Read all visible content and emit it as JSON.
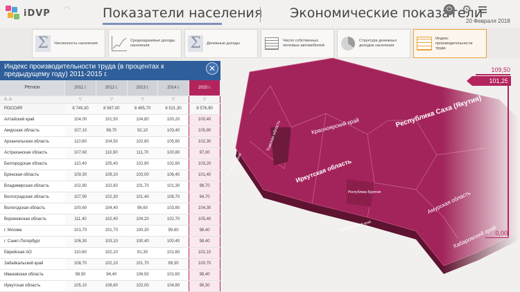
{
  "app": {
    "logo_text": "iDVP"
  },
  "header": {
    "tab_population": "Показатели населения",
    "tab_economy": "Экономические показатели",
    "date": "20 Февраля 2018"
  },
  "indicators": [
    {
      "label": "Численность населения",
      "icon": "sigma-icon"
    },
    {
      "label": "Среднедушевые доходы населения",
      "icon": "line-chart-icon"
    },
    {
      "label": "Денежные доходы",
      "icon": "sigma-icon"
    },
    {
      "label": "Число собственных легковых автомобилей",
      "icon": "grid-icon"
    },
    {
      "label": "Структура денежных доходов населения",
      "icon": "pie-chart-icon"
    },
    {
      "label": "Индекс производительности труда",
      "icon": "table-icon",
      "active": true
    }
  ],
  "panel": {
    "title": "Индекс производительности труда (в процентах к предыдущему году) 2011-2015 г.",
    "region_header": "Регион",
    "years": [
      "2011 г.",
      "2012 г.",
      "2013 г.",
      "2014 г.",
      "2015 г."
    ],
    "filter_label": "А..я",
    "filter_symbol": "▽",
    "rows": [
      {
        "name": "РОССИЯ",
        "values": [
          "8 749,30",
          "8 567,00",
          "8 495,70",
          "8 521,30",
          "8 576,90"
        ]
      },
      {
        "name": "Алтайский край",
        "values": [
          "104,00",
          "101,50",
          "104,80",
          "100,20",
          "100,40"
        ]
      },
      {
        "name": "Амурская область",
        "values": [
          "107,10",
          "98,70",
          "92,10",
          "103,40",
          "105,80"
        ]
      },
      {
        "name": "Архангельская область",
        "values": [
          "110,60",
          "104,50",
          "102,80",
          "105,60",
          "102,30"
        ]
      },
      {
        "name": "Астраханская область",
        "values": [
          "107,60",
          "110,90",
          "111,70",
          "100,80",
          "97,00"
        ]
      },
      {
        "name": "Белгородская область",
        "values": [
          "110,40",
          "105,40",
          "102,90",
          "102,60",
          "103,20"
        ]
      },
      {
        "name": "Брянская область",
        "values": [
          "109,30",
          "109,10",
          "103,00",
          "106,40",
          "101,40"
        ]
      },
      {
        "name": "Владимирская область",
        "values": [
          "102,80",
          "102,60",
          "101,70",
          "101,30",
          "98,70"
        ]
      },
      {
        "name": "Волгоградская область",
        "values": [
          "107,90",
          "102,30",
          "101,40",
          "106,70",
          "94,70"
        ]
      },
      {
        "name": "Вологодская область",
        "values": [
          "100,60",
          "104,40",
          "96,60",
          "103,80",
          "104,30"
        ]
      },
      {
        "name": "Воронежская область",
        "values": [
          "111,40",
          "102,40",
          "104,20",
          "102,70",
          "105,40"
        ]
      },
      {
        "name": "г. Москва",
        "values": [
          "101,70",
          "101,70",
          "100,30",
          "99,60",
          "98,40"
        ]
      },
      {
        "name": "г. Санкт-Петербург",
        "values": [
          "106,30",
          "103,10",
          "100,40",
          "100,40",
          "98,40"
        ]
      },
      {
        "name": "Еврейская АО",
        "values": [
          "110,60",
          "102,10",
          "81,30",
          "101,60",
          "102,10"
        ]
      },
      {
        "name": "Забайкальский край",
        "values": [
          "108,70",
          "102,10",
          "101,70",
          "99,30",
          "100,70"
        ]
      },
      {
        "name": "Ивановская область",
        "values": [
          "98,50",
          "94,40",
          "106,50",
          "101,60",
          "98,40"
        ]
      },
      {
        "name": "Иркутская область",
        "values": [
          "105,10",
          "108,60",
          "102,00",
          "104,80",
          "99,30"
        ]
      }
    ]
  },
  "map": {
    "fill_color": "#9a1f4f",
    "labels": {
      "sakha": "Республика Саха (Якутия)",
      "krasnoyarsk": "Красноярский край",
      "irkutsk": "Иркутская область",
      "amur": "Амурская область",
      "khabarovsk": "Хабаровский край",
      "tomsk": "Томская область",
      "buryatia": "Республика Бурятия",
      "zabaikal": "Забайкальский край",
      "altai": "Алтайский край"
    }
  },
  "slider": {
    "max_label": "109,50",
    "current_value": "101,25",
    "min_label": "0,00"
  }
}
